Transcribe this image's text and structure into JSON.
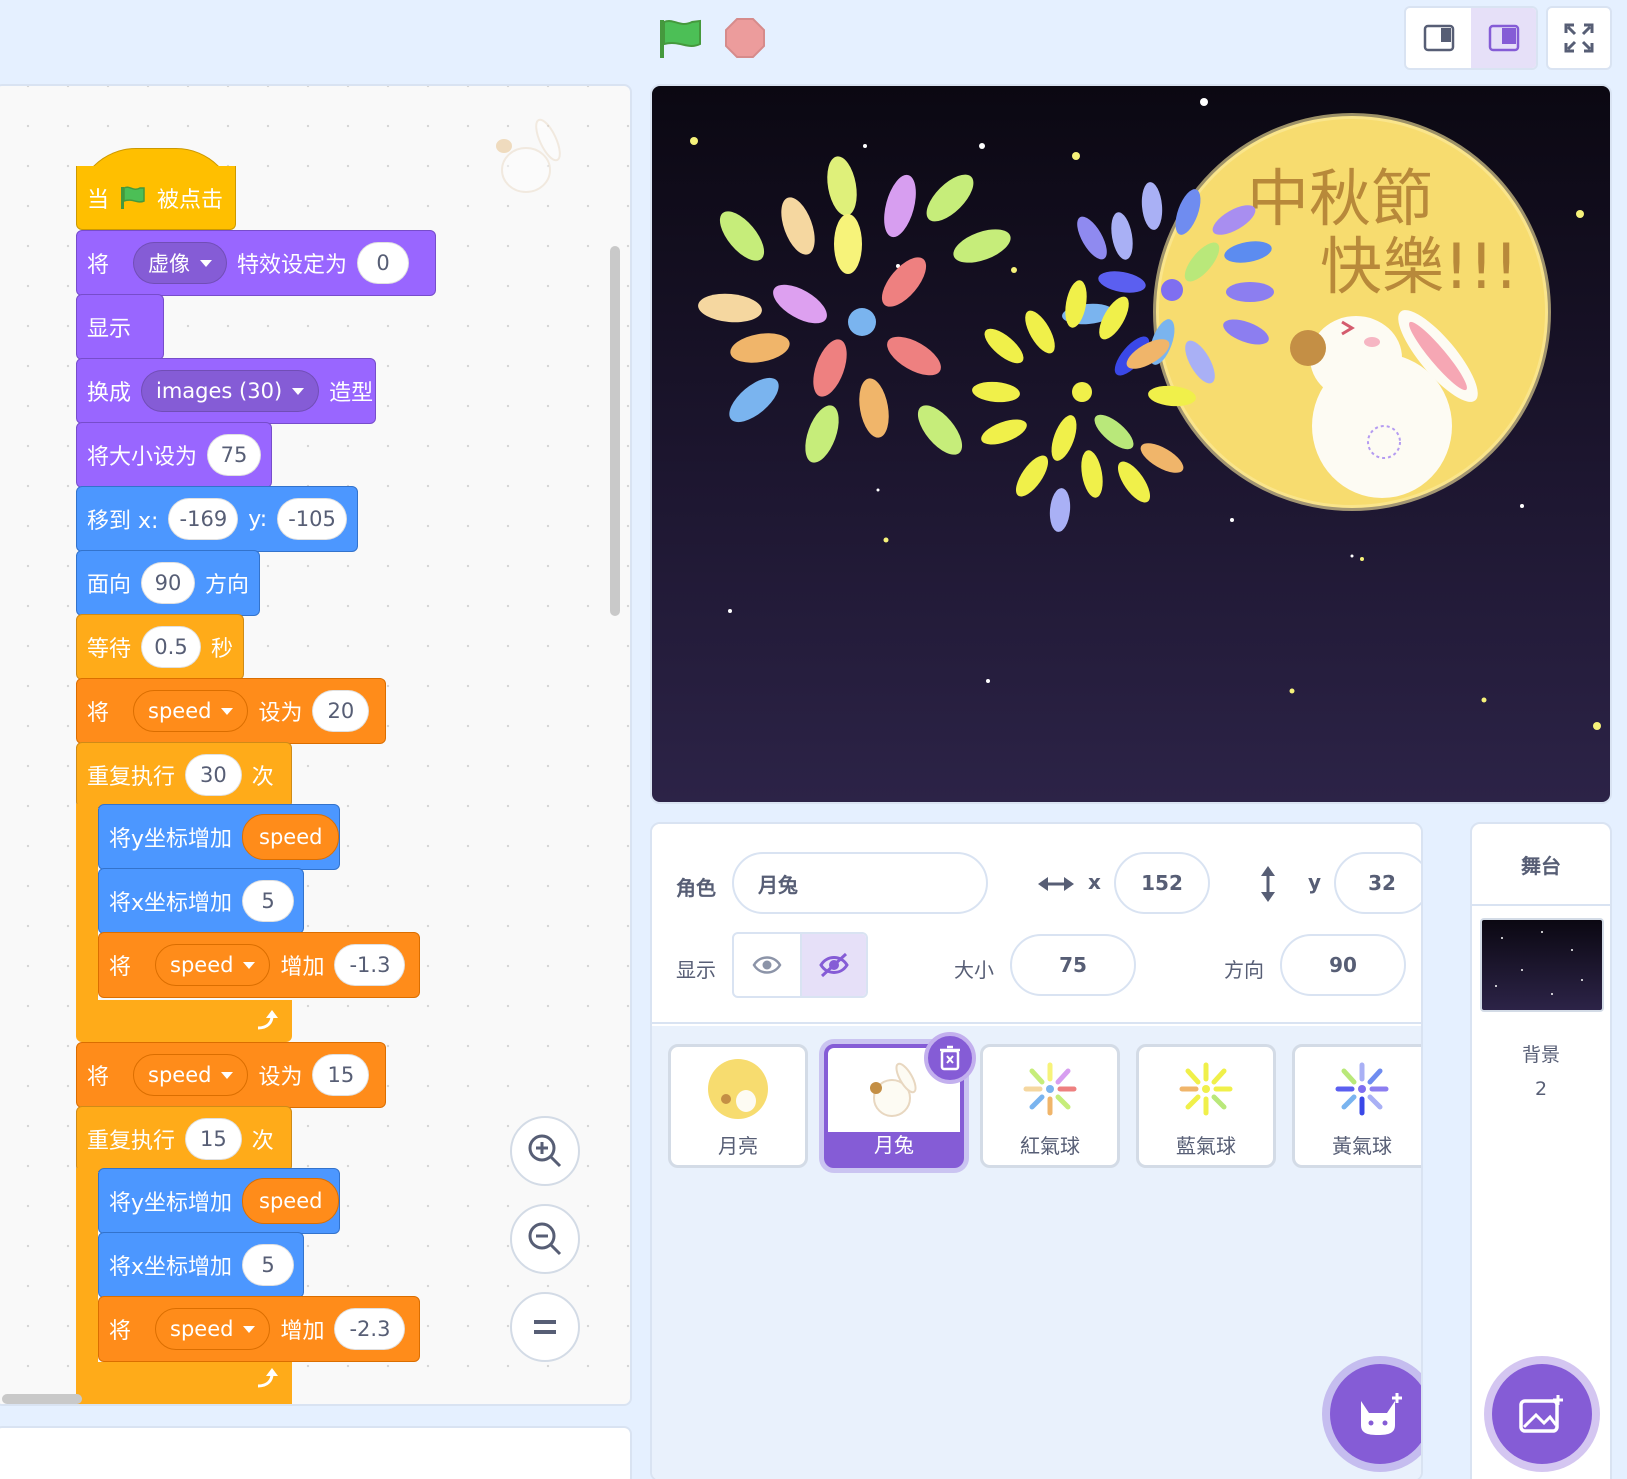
{
  "stage_controls": {
    "green_flag": "green-flag-icon",
    "stop": "stop-icon",
    "layout_small": "small-stage-icon",
    "layout_large": "large-stage-icon",
    "fullscreen": "fullscreen-icon"
  },
  "script": {
    "hat": {
      "prefix": "当",
      "suffix": "被点击"
    },
    "set_effect": {
      "prefix": "将",
      "effect": "虚像",
      "middle": "特效设定为",
      "value": "0"
    },
    "show": {
      "label": "显示"
    },
    "switch_costume": {
      "prefix": "换成",
      "costume": "images (30)",
      "suffix": "造型"
    },
    "set_size": {
      "label": "将大小设为",
      "value": "75"
    },
    "go_to": {
      "label": "移到 x:",
      "x": "-169",
      "ylabel": "y:",
      "y": "-105"
    },
    "point_dir": {
      "prefix": "面向",
      "value": "90",
      "suffix": "方向"
    },
    "wait": {
      "prefix": "等待",
      "value": "0.5",
      "suffix": "秒"
    },
    "set_speed_1": {
      "prefix": "将",
      "var": "speed",
      "middle": "设为",
      "value": "20"
    },
    "repeat_1": {
      "prefix": "重复执行",
      "value": "30",
      "suffix": "次"
    },
    "change_y_1": {
      "label": "将y坐标增加",
      "var": "speed"
    },
    "change_x_1": {
      "label": "将x坐标增加",
      "value": "5"
    },
    "change_speed_1": {
      "prefix": "将",
      "var": "speed",
      "middle": "增加",
      "value": "-1.3"
    },
    "set_speed_2": {
      "prefix": "将",
      "var": "speed",
      "middle": "设为",
      "value": "15"
    },
    "repeat_2": {
      "prefix": "重复执行",
      "value": "15",
      "suffix": "次"
    },
    "change_y_2": {
      "label": "将y坐标增加",
      "var": "speed"
    },
    "change_x_2": {
      "label": "将x坐标增加",
      "value": "5"
    },
    "change_speed_2": {
      "prefix": "将",
      "var": "speed",
      "middle": "增加",
      "value": "-2.3"
    }
  },
  "zoom": {
    "in": "zoom-in-icon",
    "out": "zoom-out-icon",
    "reset": "zoom-reset-icon"
  },
  "stage": {
    "title_line1": "中秋節",
    "title_line2": "快樂!!!",
    "colors": {
      "moon": "#f9e07a",
      "sky_top": "#0b0812",
      "sky_bottom": "#2c2347"
    }
  },
  "sprite_info": {
    "sprite_label": "角色",
    "sprite_name": "月兔",
    "x_label": "x",
    "x_value": "152",
    "y_label": "y",
    "y_value": "32",
    "show_label": "显示",
    "size_label": "大小",
    "size_value": "75",
    "direction_label": "方向",
    "direction_value": "90"
  },
  "sprites": [
    {
      "name": "月亮",
      "selected": false
    },
    {
      "name": "月兔",
      "selected": true
    },
    {
      "name": "紅氣球",
      "selected": false
    },
    {
      "name": "藍氣球",
      "selected": false
    },
    {
      "name": "黃氣球",
      "selected": false
    }
  ],
  "stage_selector": {
    "title": "舞台",
    "backdrops_label": "背景",
    "backdrops_count": "2"
  },
  "colors": {
    "accent": "#855cd6",
    "events": "#ffbf00",
    "looks": "#9966ff",
    "motion": "#4c97ff",
    "control": "#ffab19",
    "variables": "#ff8c1a"
  }
}
